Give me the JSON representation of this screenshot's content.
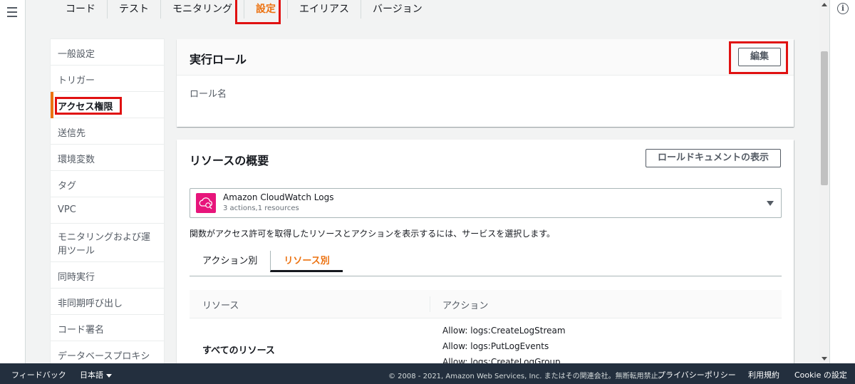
{
  "top_tabs": [
    {
      "label": "コード"
    },
    {
      "label": "テスト"
    },
    {
      "label": "モニタリング"
    },
    {
      "label": "設定"
    },
    {
      "label": "エイリアス"
    },
    {
      "label": "バージョン"
    }
  ],
  "side_nav": [
    {
      "label": "一般設定"
    },
    {
      "label": "トリガー"
    },
    {
      "label": "アクセス権限"
    },
    {
      "label": "送信先"
    },
    {
      "label": "環境変数"
    },
    {
      "label": "タグ"
    },
    {
      "label": "VPC"
    },
    {
      "label": "モニタリングおよび運用ツール"
    },
    {
      "label": "同時実行"
    },
    {
      "label": "非同期呼び出し"
    },
    {
      "label": "コード署名"
    },
    {
      "label": "データベースプロキシ"
    }
  ],
  "execution_role": {
    "title": "実行ロール",
    "edit_label": "編集",
    "role_name_label": "ロール名"
  },
  "resource_summary": {
    "title": "リソースの概要",
    "view_document_label": "ロールドキュメントの表示",
    "service": {
      "name": "Amazon CloudWatch Logs",
      "detail": "3 actions,1 resources",
      "icon": "cloudwatch-logs-icon"
    },
    "hint": "関数がアクセス許可を取得したリソースとアクションを表示するには、サービスを選択します。",
    "tabs": [
      {
        "label": "アクション別"
      },
      {
        "label": "リソース別"
      }
    ],
    "table": {
      "headers": [
        "リソース",
        "アクション"
      ],
      "rows": [
        {
          "resource": "すべてのリソース",
          "actions": [
            "Allow: logs:CreateLogStream",
            "Allow: logs:PutLogEvents",
            "Allow: logs:CreateLogGroup"
          ]
        }
      ]
    }
  },
  "footer": {
    "feedback": "フィードバック",
    "language": "日本語",
    "copyright": "© 2008 - 2021, Amazon Web Services, Inc. またはその関連会社。無断転用禁止。",
    "privacy": "プライバシーポリシー",
    "terms": "利用規約",
    "cookie": "Cookie の設定"
  },
  "colors": {
    "accent": "#ec7211",
    "highlight": "#e01111",
    "footer_bg": "#232f3e",
    "service_icon_bg": "#e7157b"
  }
}
